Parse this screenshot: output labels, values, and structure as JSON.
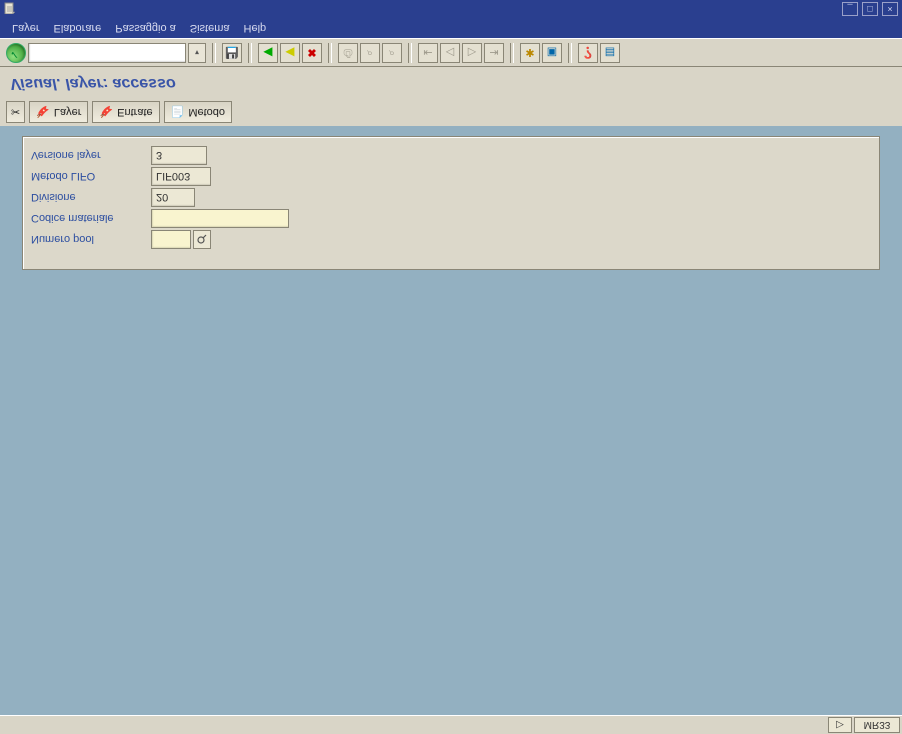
{
  "menubar": {
    "items": [
      "Layer",
      "Elaborare",
      "Passaggio a",
      "Sistema",
      "Help"
    ]
  },
  "window_controls": {
    "min": "_",
    "max": "□",
    "close": "×"
  },
  "standard_toolbar": {
    "enter_tooltip": "Enter",
    "command_value": "",
    "command_placeholder": "",
    "history_glyph": "▾",
    "sep": "|",
    "save_glyph": "💾",
    "back_glyph": "◄",
    "back2_glyph": "◄",
    "exit_glyph": "⦻",
    "cancel_glyph": "✖",
    "print_glyph": "⎙",
    "find_glyph": "🔍",
    "findnext_glyph": "🔎",
    "first_glyph": "⇤",
    "prev_glyph": "◁",
    "next_glyph": "▷",
    "last_glyph": "⇥",
    "new_glyph": "✱",
    "shortcut_glyph": "▣",
    "help_glyph": "❓",
    "layout_glyph": "▤"
  },
  "page": {
    "title": "Visual. layer: accesso"
  },
  "app_toolbar": {
    "tool_glyph": "✂",
    "btn1_icon": "🔖",
    "btn1_label": "Layer",
    "btn2_icon": "🔖",
    "btn2_label": "Entrate",
    "btn3_icon": "📄",
    "btn3_label": "Metodo"
  },
  "panel": {
    "fields": {
      "versione_layer": {
        "label": "Versione layer",
        "value": "3"
      },
      "metodo_lifo": {
        "label": "Metodo LIFO",
        "value": "LIF003"
      },
      "divisione": {
        "label": "Divisione",
        "value": "20"
      },
      "codice_materiale": {
        "label": "Codice materiale",
        "value": ""
      },
      "numero_pool": {
        "label": "Numero pool",
        "value": ""
      }
    },
    "f4_glyph": "⌕"
  },
  "statusbar": {
    "expand_glyph": "▷",
    "tcode": "MR33"
  }
}
